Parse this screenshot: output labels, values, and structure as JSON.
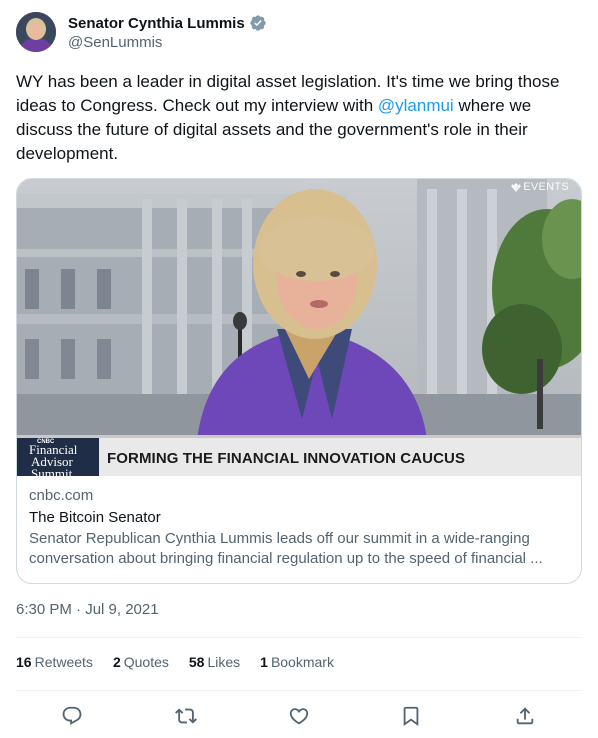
{
  "author": {
    "name": "Senator Cynthia Lummis",
    "handle": "@SenLummis",
    "verified_icon": "verified-badge-icon",
    "verified_color": "#829aab"
  },
  "tweet": {
    "text_before": "WY has been a leader in digital asset legislation. It's time we bring those ideas to Congress. Check out my interview with ",
    "mention": "@ylanmui",
    "text_after": " where we discuss the future of digital assets and the government's role in their development."
  },
  "card": {
    "image": {
      "watermark": "EVENTS",
      "logo_small": "CNBC",
      "logo_line1": "Financial",
      "logo_line2": "Advisor",
      "logo_line3": "Summit",
      "lower_third": "FORMING THE FINANCIAL INNOVATION CAUCUS"
    },
    "domain": "cnbc.com",
    "title": "The Bitcoin Senator",
    "description_line1": "Senator Republican Cynthia Lummis leads off our summit in a wide-ranging",
    "description_line2": "conversation about bringing financial regulation up to the speed of financial ..."
  },
  "timestamp": "6:30 PM · Jul 9, 2021",
  "stats": {
    "retweets_count": "16",
    "retweets_label": "Retweets",
    "quotes_count": "2",
    "quotes_label": "Quotes",
    "likes_count": "58",
    "likes_label": "Likes",
    "bookmarks_count": "1",
    "bookmarks_label": "Bookmark"
  },
  "actions": {
    "reply_icon": "reply-icon",
    "retweet_icon": "retweet-icon",
    "like_icon": "heart-icon",
    "bookmark_icon": "bookmark-icon",
    "share_icon": "share-icon"
  },
  "colors": {
    "link": "#1d9bf0",
    "secondary_text": "#536471",
    "border": "#cfd9de"
  }
}
